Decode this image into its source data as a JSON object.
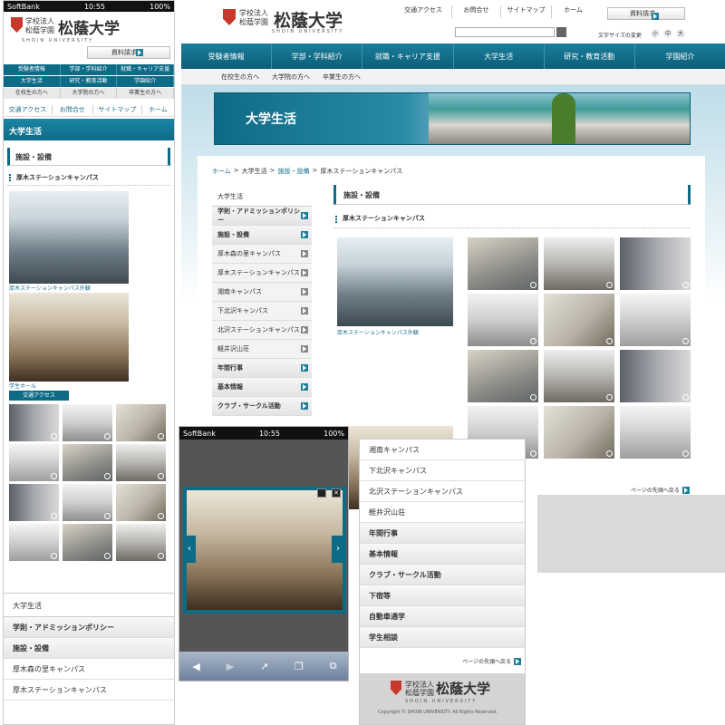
{
  "logo": {
    "line1": "学校法人",
    "line2": "松蔭学園",
    "name": "松蔭大学",
    "en": "SHOIN UNIVERSITY"
  },
  "status": {
    "carrier": "SoftBank",
    "time": "10:55",
    "battery": "100%"
  },
  "desktop": {
    "top_links": [
      "交通アクセス",
      "お問合せ",
      "サイトマップ",
      "ホーム"
    ],
    "request_button": "資料請求",
    "font_size_label": "文字サイズの変更",
    "font_sizes": [
      "小",
      "中",
      "大"
    ],
    "nav": [
      "受験者情報",
      "学部・学科紹介",
      "就職・キャリア支援",
      "大学生活",
      "研究・教育活動",
      "学園紹介"
    ],
    "subnav": [
      "在校生の方へ",
      "大学院の方へ",
      "卒業生の方へ"
    ],
    "banner_title": "大学生活",
    "breadcrumb": [
      "ホーム",
      "大学生活",
      "施設・設備",
      "厚木ステーションキャンパス"
    ],
    "breadcrumb_sep": ">",
    "side_title": "大学生活",
    "side_items": [
      {
        "label": "学則・アドミッションポリシー",
        "bold": true
      },
      {
        "label": "施設・設備",
        "bold": true
      },
      {
        "label": "厚木森の里キャンパス",
        "bold": false
      },
      {
        "label": "厚木ステーションキャンパス",
        "bold": false
      },
      {
        "label": "湘南キャンパス",
        "bold": false
      },
      {
        "label": "下北沢キャンパス",
        "bold": false
      },
      {
        "label": "北沢ステーションキャンパス",
        "bold": false
      },
      {
        "label": "軽井沢山荘",
        "bold": false
      },
      {
        "label": "年間行事",
        "bold": true
      },
      {
        "label": "基本情報",
        "bold": true
      },
      {
        "label": "クラブ・サークル活動",
        "bold": true
      }
    ],
    "section_title": "施設・設備",
    "sub_title": "厚木ステーションキャンパス",
    "main_caption": "厚木ステーションキャンパス外観",
    "to_top": "ページの先頭へ戻る"
  },
  "mobile": {
    "request_button": "資料請求",
    "menu": [
      [
        "受験者情報",
        "学部・学科紹介",
        "就職・キャリア支援"
      ],
      [
        "大学生活",
        "研究・教育活動",
        "学園紹介"
      ],
      [
        "在校生の方へ",
        "大学院の方へ",
        "卒業生の方へ"
      ]
    ],
    "links": [
      "交通アクセス",
      "お問合せ",
      "サイトマップ",
      "ホーム"
    ],
    "page_title": "大学生活",
    "section_title": "施設・設備",
    "sub_title": "厚木ステーションキャンパス",
    "caption1": "厚木ステーションキャンパス外観",
    "caption2": "学生ホール",
    "access_button": "交通アクセス",
    "bottom_title": "大学生活",
    "bottom_items": [
      {
        "label": "学則・アドミッションポリシー",
        "bold": true
      },
      {
        "label": "施設・設備",
        "bold": true
      },
      {
        "label": "厚木森の里キャンパス",
        "bold": false
      },
      {
        "label": "厚木ステーションキャンパス",
        "bold": false
      }
    ]
  },
  "list_panel": {
    "items": [
      {
        "label": "湘南キャンパス",
        "bold": false
      },
      {
        "label": "下北沢キャンパス",
        "bold": false
      },
      {
        "label": "北沢ステーションキャンパス",
        "bold": false
      },
      {
        "label": "軽井沢山荘",
        "bold": false
      },
      {
        "label": "年間行事",
        "bold": true
      },
      {
        "label": "基本情報",
        "bold": true
      },
      {
        "label": "クラブ・サークル活動",
        "bold": true
      },
      {
        "label": "下宿等",
        "bold": true
      },
      {
        "label": "自動車通学",
        "bold": true
      },
      {
        "label": "学生相談",
        "bold": true
      }
    ],
    "to_top": "ページの先頭へ戻る",
    "copyright": "Copyright © SHOIN UNIVERSITY. All Rights Reserved."
  },
  "colors": {
    "teal": "#0e6b86",
    "logo_red": "#c8382d"
  }
}
